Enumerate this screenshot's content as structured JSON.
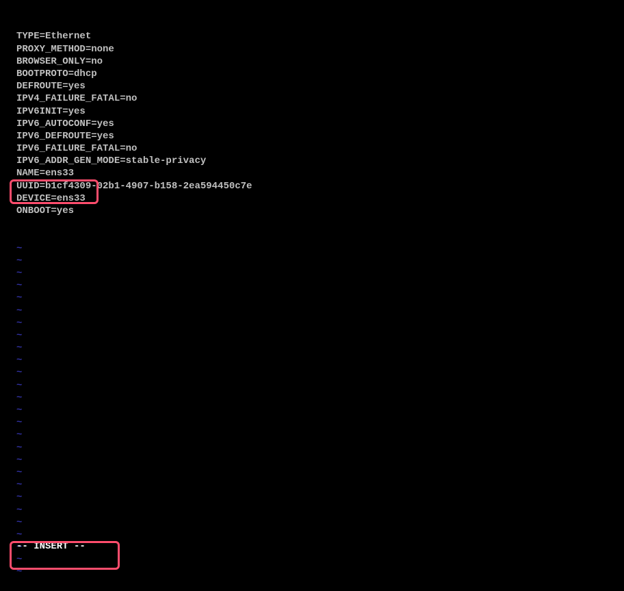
{
  "config_lines": [
    "TYPE=Ethernet",
    "PROXY_METHOD=none",
    "BROWSER_ONLY=no",
    "BOOTPROTO=dhcp",
    "DEFROUTE=yes",
    "IPV4_FAILURE_FATAL=no",
    "IPV6INIT=yes",
    "IPV6_AUTOCONF=yes",
    "IPV6_DEFROUTE=yes",
    "IPV6_FAILURE_FATAL=no",
    "IPV6_ADDR_GEN_MODE=stable-privacy",
    "NAME=ens33",
    "UUID=b1cf4309-02b1-4907-b158-2ea594450c7e",
    "DEVICE=ens33",
    "ONBOOT=yes"
  ],
  "tilde_char": "~",
  "tilde_count": 27,
  "vim_mode": "-- INSERT --"
}
